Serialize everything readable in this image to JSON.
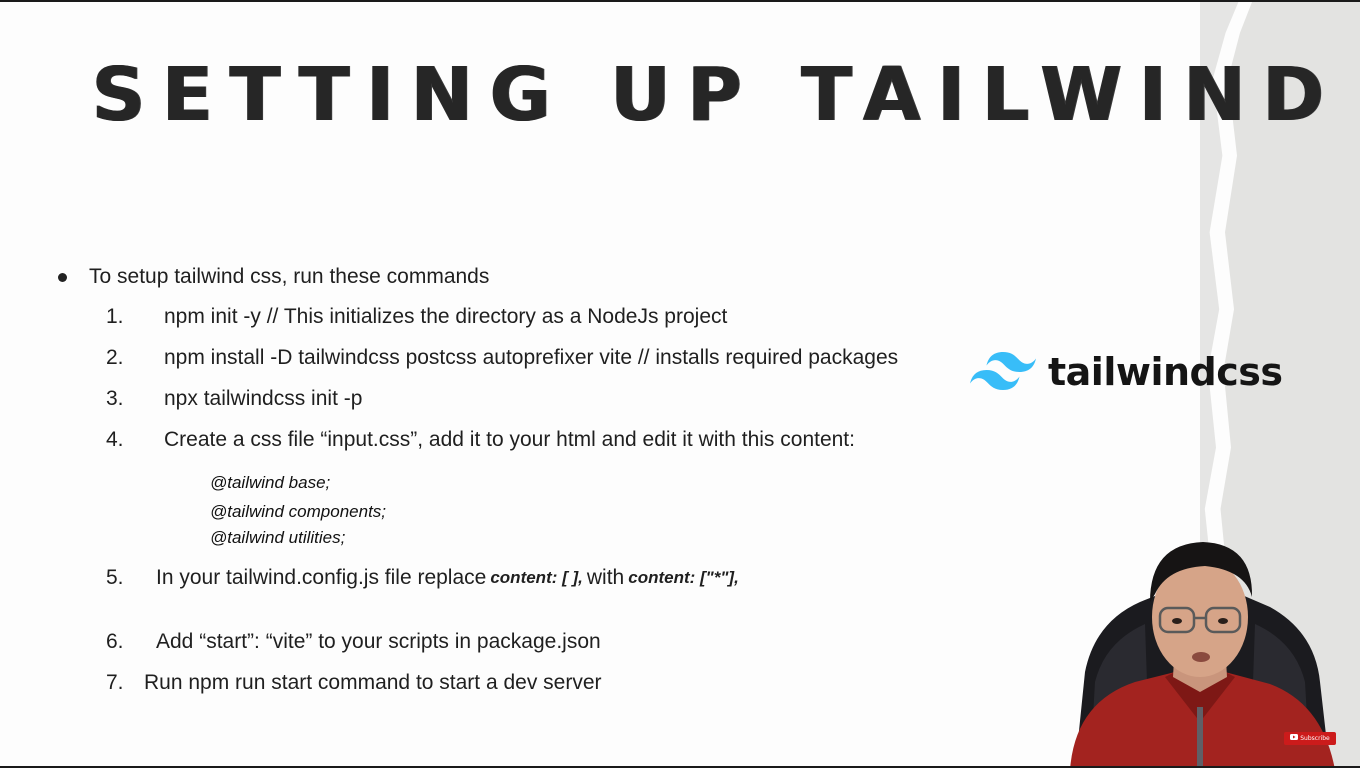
{
  "slide": {
    "title": "SETTING UP TAILWIND CSS",
    "intro": "To setup tailwind css, run these commands",
    "steps": [
      {
        "num": "1.",
        "text": "npm init -y  // This initializes the directory as a NodeJs project"
      },
      {
        "num": "2.",
        "text": "npm install -D tailwindcss postcss autoprefixer vite // installs required packages"
      },
      {
        "num": "3.",
        "text": "npx tailwindcss init -p"
      },
      {
        "num": "4.",
        "text": "Create a css file “input.css”, add it to your html and edit it with this content:"
      },
      {
        "num": "5.",
        "text_before": "In your tailwind.config.js file replace",
        "code1": "content: [ ],",
        "text_mid": "with",
        "code2": "content: [\"*\"],"
      },
      {
        "num": "6.",
        "text": "Add “start”: “vite” to your scripts in package.json"
      },
      {
        "num": "7.",
        "text": "Run npm run start command to start a dev server"
      }
    ],
    "code_lines": [
      "@tailwind base;",
      "@tailwind components;",
      "@tailwind utilities;"
    ]
  },
  "logo": {
    "text": "tailwindcss",
    "icon": "tailwind-wave-icon",
    "color": "#38bdf8"
  },
  "badge": {
    "label": "Subscribe",
    "icon": "youtube-play-icon",
    "color": "#cc1b1b"
  }
}
